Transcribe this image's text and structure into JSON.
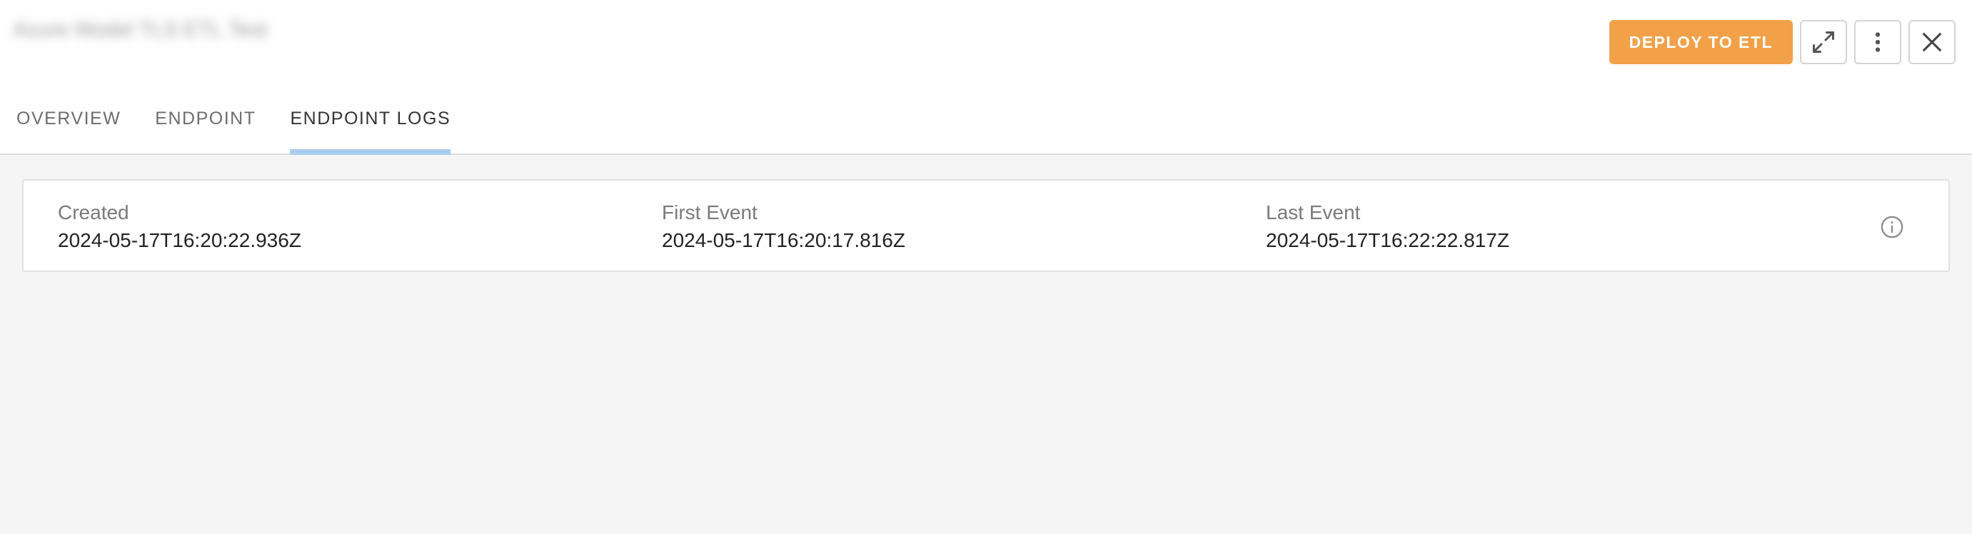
{
  "header": {
    "title": "Azure Model TLS ETL Test",
    "deploy_label": "DEPLOY TO ETL"
  },
  "icons": {
    "expand": "expand-icon",
    "more": "more-vertical-icon",
    "close": "close-icon",
    "info": "info-icon"
  },
  "tabs": [
    {
      "label": "OVERVIEW",
      "active": false
    },
    {
      "label": "ENDPOINT",
      "active": false
    },
    {
      "label": "ENDPOINT LOGS",
      "active": true
    }
  ],
  "info": {
    "created": {
      "label": "Created",
      "value": "2024-05-17T16:20:22.936Z"
    },
    "first_event": {
      "label": "First Event",
      "value": "2024-05-17T16:20:17.816Z"
    },
    "last_event": {
      "label": "Last Event",
      "value": "2024-05-17T16:22:22.817Z"
    }
  },
  "colors": {
    "accent": "#f2a149",
    "tab_indicator": "#a9cdee",
    "background": "#f5f5f5"
  }
}
